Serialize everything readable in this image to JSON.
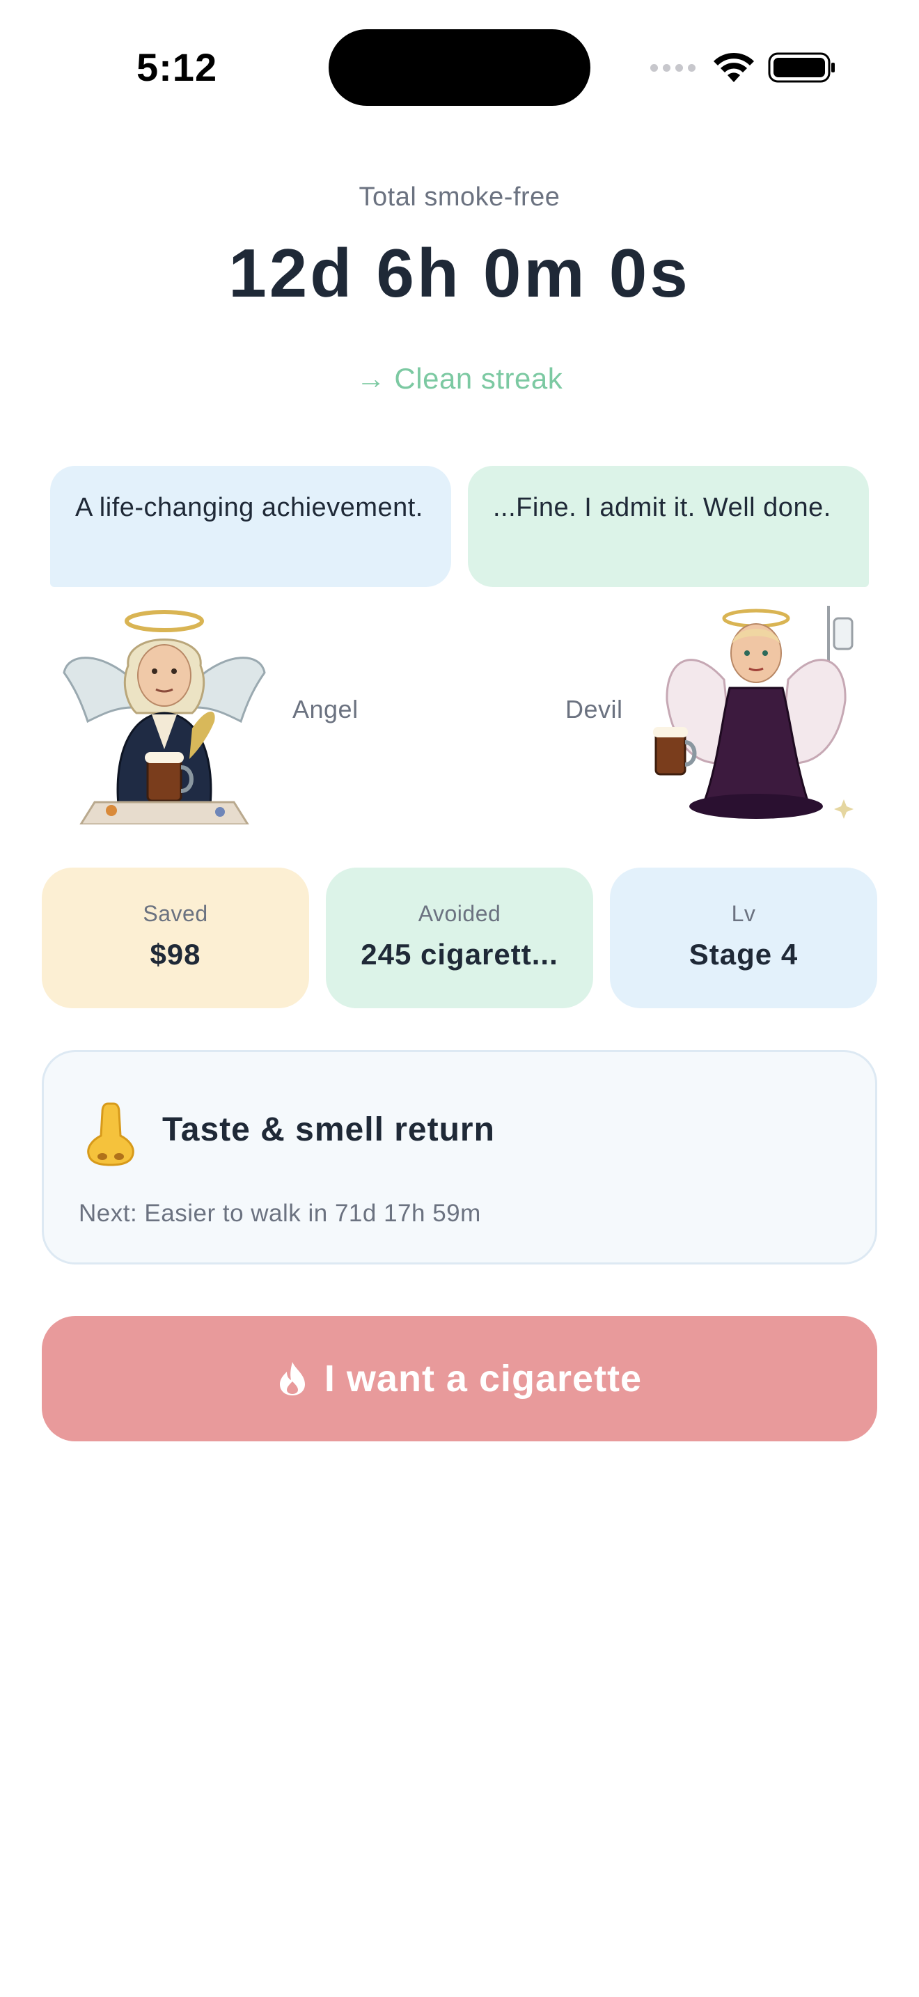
{
  "status_bar": {
    "time": "5:12"
  },
  "header": {
    "subtitle": "Total smoke-free",
    "timer": "12d 6h 0m 0s",
    "streak_link": "→ Clean streak"
  },
  "dialogue": {
    "angel_message": "A life-changing achievement.",
    "devil_message": "...Fine. I admit it. Well done.",
    "angel_name": "Angel",
    "devil_name": "Devil"
  },
  "stats": [
    {
      "label": "Saved",
      "value": "$98"
    },
    {
      "label": "Avoided",
      "value": "245 cigarett..."
    },
    {
      "label": "Lv",
      "value": "Stage 4"
    }
  ],
  "milestone": {
    "icon": "nose-icon",
    "title": "Taste & smell return",
    "next": "Next: Easier to walk in 71d 17h 59m"
  },
  "craving_button": {
    "icon": "flame-icon",
    "label": "I want a cigarette"
  },
  "colors": {
    "accent_green": "#7cc9a2",
    "craving_red": "#e89a9b",
    "saved_bg": "#fcefd3",
    "avoided_bg": "#dcf3e8",
    "level_bg": "#e3f1fb",
    "text_dark": "#1f2937",
    "text_muted": "#6b7280"
  }
}
